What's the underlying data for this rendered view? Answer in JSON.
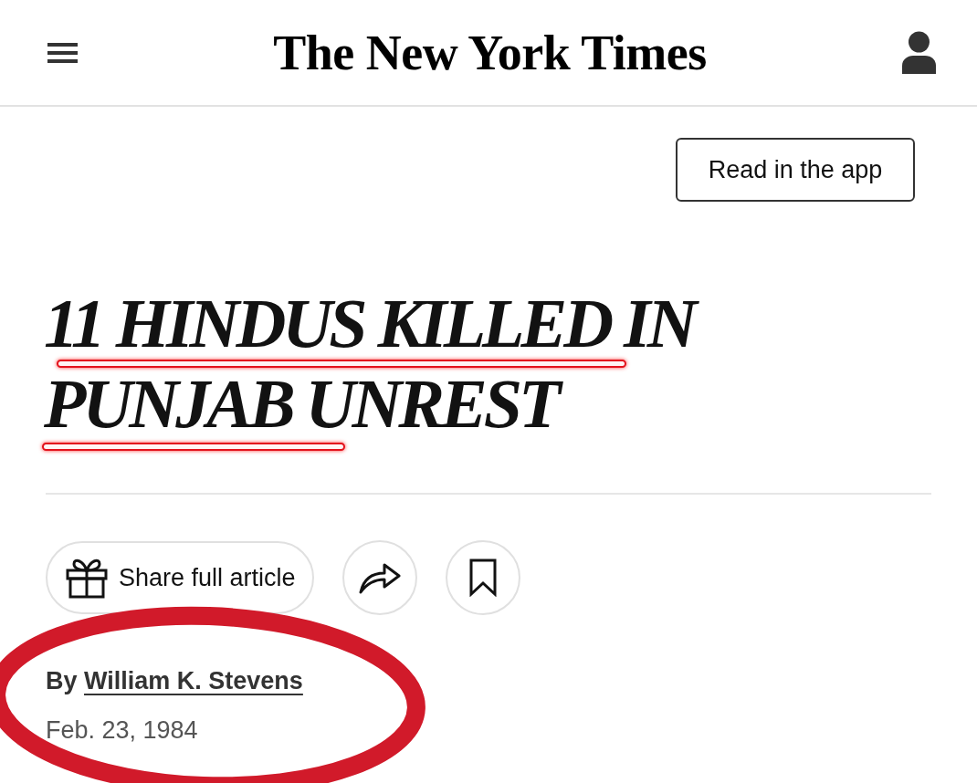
{
  "header": {
    "logo": "The New York Times"
  },
  "app_button": {
    "label": "Read in the app"
  },
  "headline": {
    "lines": [
      "11 HINDUS KILLED IN",
      "PUNJAB UNREST"
    ]
  },
  "actions": {
    "share_label": "Share full article"
  },
  "byline": {
    "prefix": "By",
    "author": "William K. Stevens",
    "date": "Feb. 23, 1984"
  }
}
